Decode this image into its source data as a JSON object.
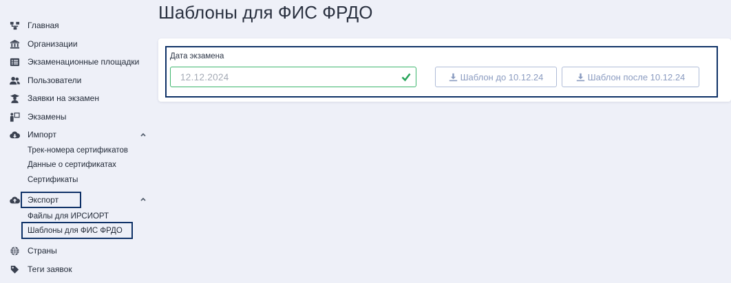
{
  "page": {
    "title": "Шаблоны для ФИС ФРДО"
  },
  "sidebar": {
    "items": [
      {
        "label": "Главная",
        "icon": "sitemap-icon"
      },
      {
        "label": "Организации",
        "icon": "institution-icon"
      },
      {
        "label": "Экзаменационные площадки",
        "icon": "list-icon"
      },
      {
        "label": "Пользователи",
        "icon": "users-icon"
      },
      {
        "label": "Заявки на экзамен",
        "icon": "graduate-icon"
      },
      {
        "label": "Экзамены",
        "icon": "presenter-icon"
      },
      {
        "label": "Импорт",
        "icon": "cloud-download-icon",
        "children": [
          "Трек-номера сертификатов",
          "Данные о сертификатах",
          "Сертификаты"
        ]
      },
      {
        "label": "Экспорт",
        "icon": "cloud-upload-icon",
        "children": [
          "Файлы для ИРСИОРТ",
          "Шаблоны для ФИС ФРДО"
        ]
      },
      {
        "label": "Страны",
        "icon": "globe-icon"
      },
      {
        "label": "Теги заявок",
        "icon": "tag-icon"
      }
    ]
  },
  "form": {
    "date_label": "Дата экзамена",
    "date_value": "12.12.2024",
    "btn_before": "Шаблон до 10.12.24",
    "btn_after": "Шаблон после 10.12.24"
  },
  "colors": {
    "background": "#eef0f8",
    "highlight": "#0d3066",
    "valid": "#3ab56b",
    "button_text": "#8a9bc0"
  }
}
